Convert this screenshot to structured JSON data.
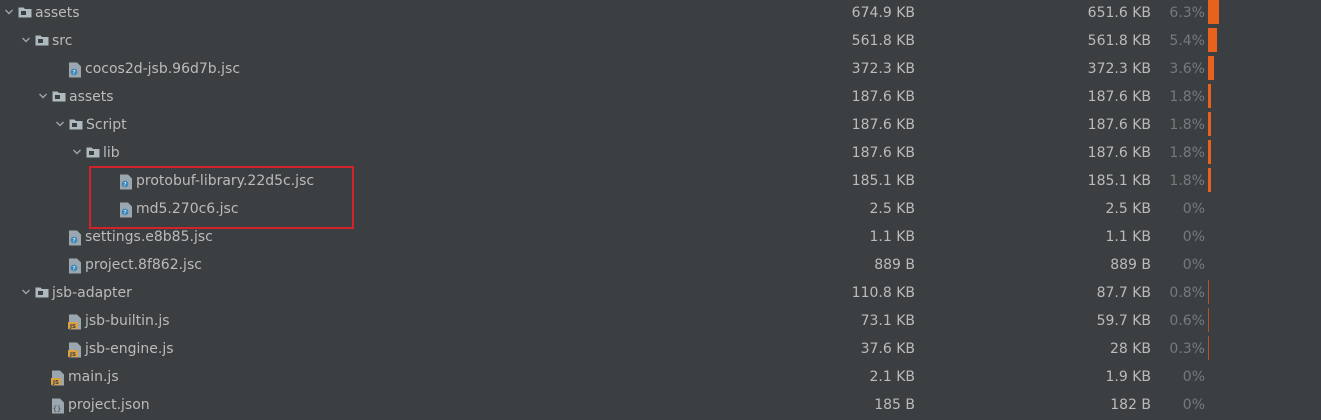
{
  "tree": {
    "rows": [
      {
        "name": "assets",
        "size": "674.9 KB",
        "disk_size": "651.6 KB",
        "percent": "6.3%",
        "percent_value": 6.3,
        "type": "folder",
        "depth": 0,
        "expanded": true
      },
      {
        "name": "src",
        "size": "561.8 KB",
        "disk_size": "561.8 KB",
        "percent": "5.4%",
        "percent_value": 5.4,
        "type": "folder",
        "depth": 1,
        "expanded": true
      },
      {
        "name": "cocos2d-jsb.96d7b.jsc",
        "size": "372.3 KB",
        "disk_size": "372.3 KB",
        "percent": "3.6%",
        "percent_value": 3.6,
        "type": "unknown",
        "depth": 2
      },
      {
        "name": "assets",
        "size": "187.6 KB",
        "disk_size": "187.6 KB",
        "percent": "1.8%",
        "percent_value": 1.8,
        "type": "folder",
        "depth": 2,
        "expanded": true
      },
      {
        "name": "Script",
        "size": "187.6 KB",
        "disk_size": "187.6 KB",
        "percent": "1.8%",
        "percent_value": 1.8,
        "type": "folder",
        "depth": 3,
        "expanded": true
      },
      {
        "name": "lib",
        "size": "187.6 KB",
        "disk_size": "187.6 KB",
        "percent": "1.8%",
        "percent_value": 1.8,
        "type": "folder",
        "depth": 4,
        "expanded": true
      },
      {
        "name": "protobuf-library.22d5c.jsc",
        "size": "185.1 KB",
        "disk_size": "185.1 KB",
        "percent": "1.8%",
        "percent_value": 1.8,
        "type": "unknown",
        "depth": 5
      },
      {
        "name": "md5.270c6.jsc",
        "size": "2.5 KB",
        "disk_size": "2.5 KB",
        "percent": "0%",
        "percent_value": 0,
        "type": "unknown",
        "depth": 5
      },
      {
        "name": "settings.e8b85.jsc",
        "size": "1.1 KB",
        "disk_size": "1.1 KB",
        "percent": "0%",
        "percent_value": 0,
        "type": "unknown",
        "depth": 2
      },
      {
        "name": "project.8f862.jsc",
        "size": "889 B",
        "disk_size": "889 B",
        "percent": "0%",
        "percent_value": 0,
        "type": "unknown",
        "depth": 2
      },
      {
        "name": "jsb-adapter",
        "size": "110.8 KB",
        "disk_size": "87.7 KB",
        "percent": "0.8%",
        "percent_value": 0.8,
        "type": "folder",
        "depth": 1,
        "expanded": true
      },
      {
        "name": "jsb-builtin.js",
        "size": "73.1 KB",
        "disk_size": "59.7 KB",
        "percent": "0.6%",
        "percent_value": 0.6,
        "type": "js",
        "depth": 2
      },
      {
        "name": "jsb-engine.js",
        "size": "37.6 KB",
        "disk_size": "28 KB",
        "percent": "0.3%",
        "percent_value": 0.3,
        "type": "js",
        "depth": 2
      },
      {
        "name": "main.js",
        "size": "2.1 KB",
        "disk_size": "1.9 KB",
        "percent": "0%",
        "percent_value": 0,
        "type": "js",
        "depth": 1
      },
      {
        "name": "project.json",
        "size": "185 B",
        "disk_size": "182 B",
        "percent": "0%",
        "percent_value": 0,
        "type": "json",
        "depth": 1
      }
    ]
  },
  "icons": {
    "folder": "folder-icon",
    "unknown": "unknown-file-icon",
    "js": "js-file-icon",
    "json": "json-file-icon",
    "chevron": "chevron-down-icon"
  },
  "colors": {
    "background": "#3c3f41",
    "text": "#bbbbbb",
    "percent_text": "#777a7c",
    "bar": "#e8621b",
    "highlight_border": "#d2232a"
  }
}
